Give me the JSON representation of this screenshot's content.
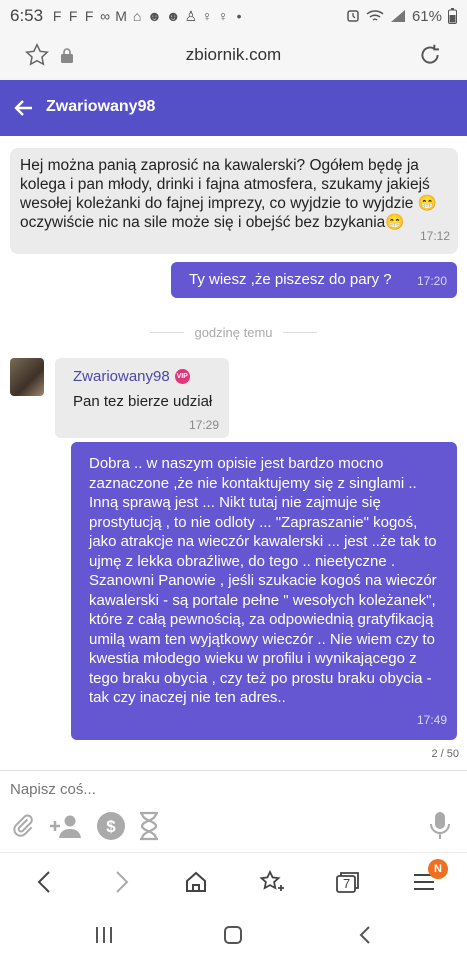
{
  "status": {
    "time": "6:53",
    "notifications": [
      "F",
      "F",
      "F",
      "∞",
      "M",
      "⌂",
      "☻",
      "☻",
      "♙",
      "♀",
      "♀",
      "•"
    ],
    "battery": "61%",
    "icons": [
      "alarm-icon",
      "wifi-icon",
      "signal-icon",
      "battery-icon"
    ]
  },
  "browser": {
    "domain": "zbiornik.com"
  },
  "header": {
    "title": "Zwariowany98"
  },
  "messages": [
    {
      "direction": "in",
      "text": "Hej można panią zaprosić na kawalerski? Ogółem będę ja kolega i pan młody, drinki i fajna atmosfera, szukamy jakiejś wesołej koleżanki do fajnej imprezy, co wyjdzie to wyjdzie 😁 oczywiście nic na sile może się i obejść bez bzykania😁",
      "time": "17:12"
    },
    {
      "direction": "out",
      "text": "Ty wiesz ,że piszesz do pary ?",
      "time": "17:20"
    }
  ],
  "divider": "godzinę temu",
  "card_message": {
    "sender": "Zwariowany98",
    "vip": "VIP",
    "text": "Pan tez bierze udział",
    "time": "17:29"
  },
  "long_message": {
    "text": "Dobra .. w naszym opisie jest bardzo mocno zaznaczone ,że nie kontaktujemy się z singlami .. Inną sprawą jest ... Nikt tutaj nie zajmuje się prostytucją , to nie odloty ... \"Zapraszanie\" kogoś, jako atrakcje na wieczór kawalerski ... jest ..że tak to ujmę z lekka obraźliwe, do tego .. nieetyczne . Szanowni Panowie , jeśli szukacie kogoś na wieczór kawalerski - są portale pełne \" wesołych koleżanek\", które z całą pewnością, za odpowiednią gratyfikacją umilą wam ten wyjątkowy wieczór .. Nie wiem czy to kwestia młodego wieku w profilu i wynikającego z tego braku obycia , czy też po prostu braku obycia - tak czy inaczej nie ten adres..",
    "time": "17:49"
  },
  "counter": "2 / 50",
  "composer": {
    "placeholder": "Napisz coś..."
  },
  "browser_nav": {
    "tabs_count": "7",
    "menu_badge": "N"
  },
  "colors": {
    "accent": "#5550c8",
    "outgoing_bubble": "#6557d1",
    "incoming_bubble": "#ebebeb",
    "vip_badge": "#e2357a",
    "menu_badge": "#f07021"
  }
}
